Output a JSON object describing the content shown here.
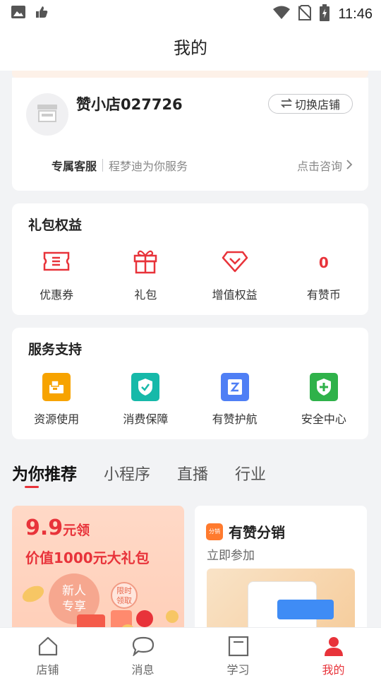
{
  "status_bar": {
    "time": "11:46"
  },
  "header": {
    "title": "我的"
  },
  "store": {
    "name": "赞小店027726",
    "switch_label": "切换店铺",
    "service_label": "专属客服",
    "service_text": "程梦迪为你服务",
    "consult_label": "点击咨询"
  },
  "gift": {
    "title": "礼包权益",
    "items": [
      {
        "label": "优惠券",
        "icon": "ticket-icon"
      },
      {
        "label": "礼包",
        "icon": "gift-icon"
      },
      {
        "label": "增值权益",
        "icon": "diamond-icon"
      },
      {
        "label": "有赞币",
        "value": "0"
      }
    ]
  },
  "services": {
    "title": "服务支持",
    "items": [
      {
        "label": "资源使用",
        "icon": "resource-icon",
        "color": "#f7a300"
      },
      {
        "label": "消费保障",
        "icon": "shield-check-icon",
        "color": "#16b9a9"
      },
      {
        "label": "有赞护航",
        "icon": "escort-icon",
        "color": "#4f7ff5"
      },
      {
        "label": "安全中心",
        "icon": "shield-plus-icon",
        "color": "#2fb24a"
      }
    ]
  },
  "tabs": [
    "为你推荐",
    "小程序",
    "直播",
    "行业"
  ],
  "promo_left": {
    "amount": "9.9",
    "unit": "元领",
    "subtitle": "价值1000元大礼包",
    "badge": "新人专享",
    "limited": "限时领取"
  },
  "promo_right": {
    "logo_text": "分销",
    "title": "有赞分销",
    "subtitle": "立即参加"
  },
  "bottom_nav": [
    {
      "label": "店铺",
      "icon": "home-icon"
    },
    {
      "label": "消息",
      "icon": "message-icon"
    },
    {
      "label": "学习",
      "icon": "study-icon"
    },
    {
      "label": "我的",
      "icon": "user-icon",
      "active": true
    }
  ],
  "colors": {
    "accent": "#e8333a",
    "background": "#f2f3f5"
  }
}
